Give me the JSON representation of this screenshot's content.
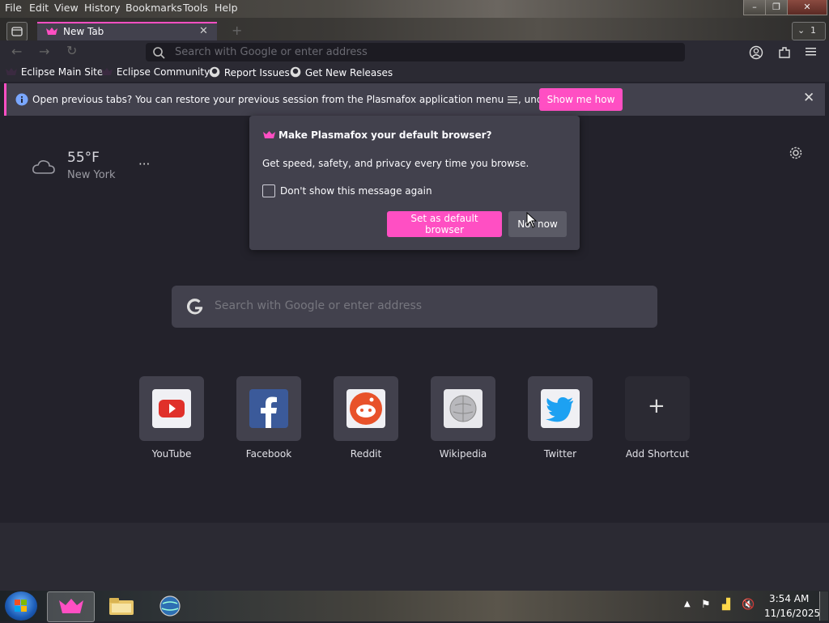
{
  "menubar": {
    "items": [
      "File",
      "Edit",
      "View",
      "History",
      "Bookmarks",
      "Tools",
      "Help"
    ],
    "mnemonics": [
      "F",
      "E",
      "V",
      "s",
      "B",
      "T",
      "H"
    ]
  },
  "window_controls": {
    "minimize": "–",
    "restore": "❐",
    "close": "✕"
  },
  "tabs": {
    "active_title": "New Tab",
    "close_glyph": "✕",
    "new_tab_glyph": "+",
    "tab_count": "1"
  },
  "urlbar": {
    "placeholder": "Search with Google or enter address"
  },
  "bookmarks": [
    "Eclipse Main Site",
    "Eclipse Community",
    "Report Issues",
    "Get New Releases"
  ],
  "notification": {
    "text_before": "Open previous tabs? You can restore your previous session from the Plasmafox application menu",
    "text_after": ", under History.",
    "button": "Show me how"
  },
  "default_browser_popup": {
    "title": "Make Plasmafox your default browser?",
    "body": "Get speed, safety, and privacy every time you browse.",
    "checkbox_label": "Don't show this message again",
    "primary_button": "Set as default browser",
    "secondary_button": "Not now"
  },
  "weather": {
    "temperature": "55°F",
    "location": "New York",
    "menu": "···"
  },
  "search": {
    "placeholder": "Search with Google or enter address"
  },
  "shortcuts": [
    {
      "label": "YouTube"
    },
    {
      "label": "Facebook"
    },
    {
      "label": "Reddit"
    },
    {
      "label": "Wikipedia"
    },
    {
      "label": "Twitter"
    },
    {
      "label": "Add Shortcut"
    }
  ],
  "taskbar": {
    "time": "3:54 AM",
    "date": "11/16/2025"
  },
  "colors": {
    "accent": "#ff4fc3",
    "panel": "#42414d",
    "background": "#23222b"
  }
}
